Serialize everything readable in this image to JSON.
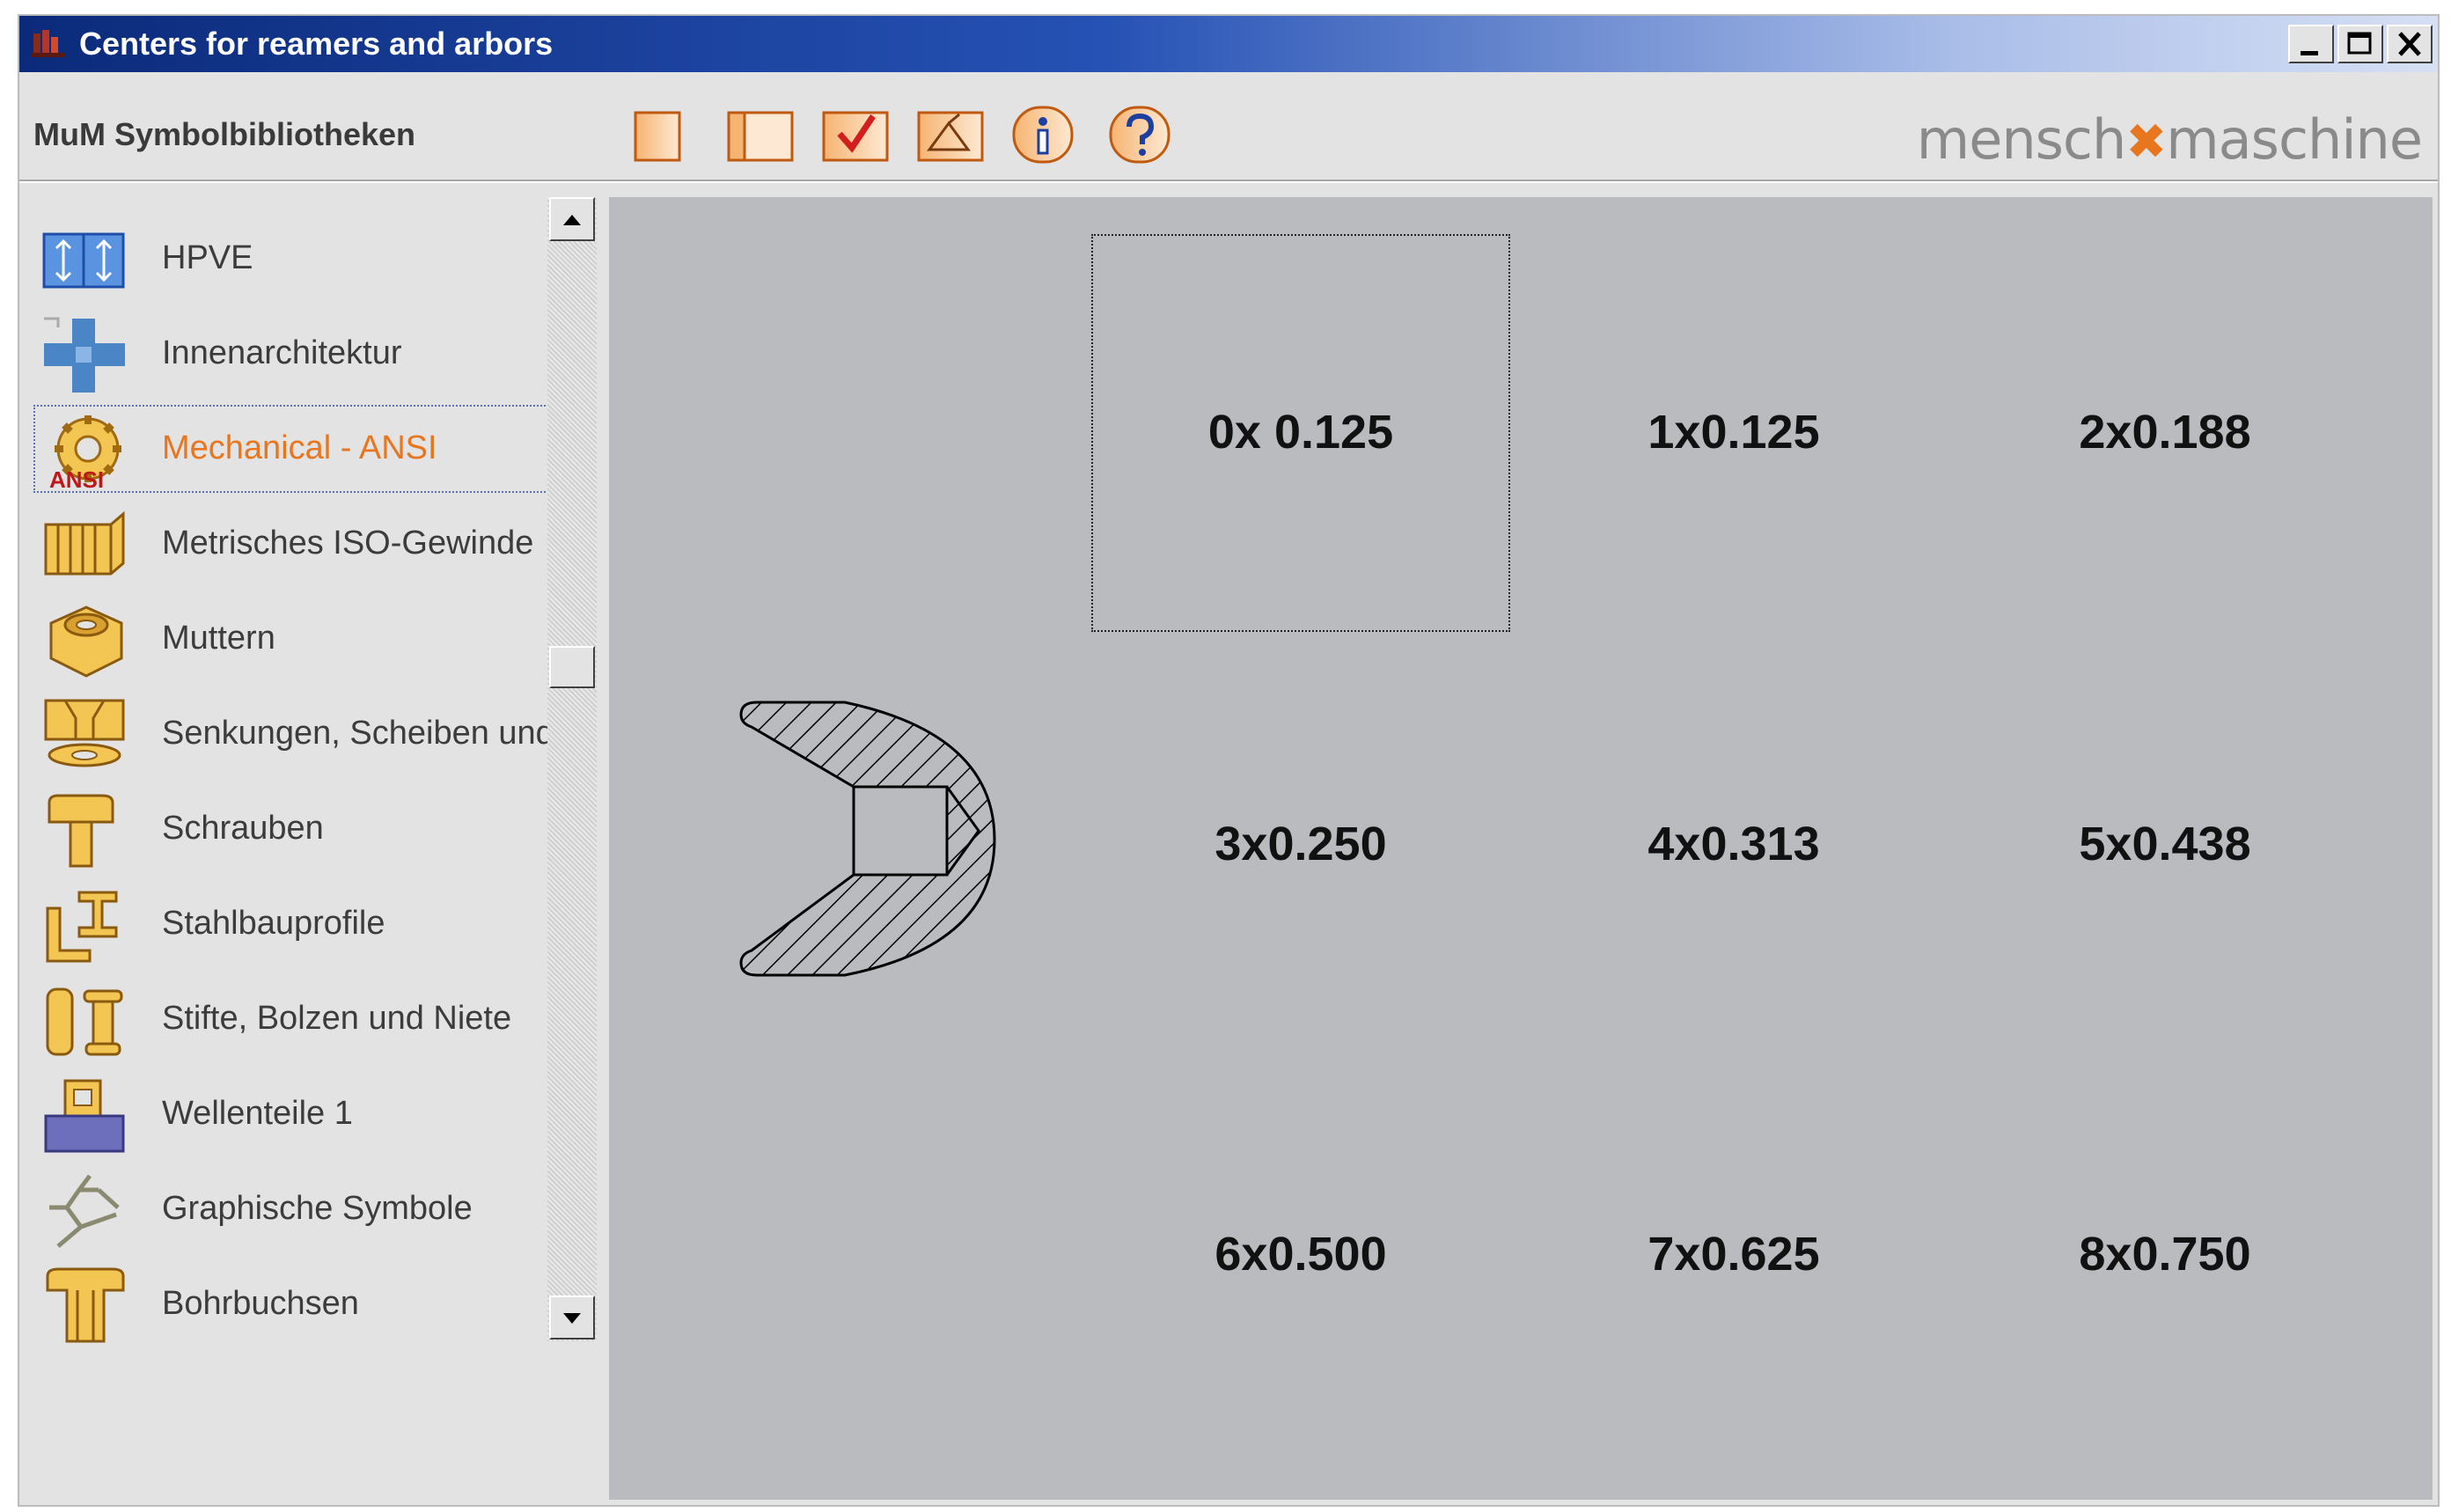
{
  "window": {
    "title": "Centers for reamers and arbors",
    "buttons": [
      "minimize",
      "maximize",
      "close"
    ]
  },
  "toolbar": {
    "label": "MuM Symbolbibliotheken",
    "tools": [
      {
        "icon": "single-page-icon"
      },
      {
        "icon": "two-panel-icon"
      },
      {
        "icon": "check-icon"
      },
      {
        "icon": "insert-icon"
      },
      {
        "icon": "info-icon"
      },
      {
        "icon": "help-icon"
      }
    ],
    "brand": {
      "left": "mensch",
      "right": "maschine"
    }
  },
  "sidebar": {
    "items": [
      {
        "label": "HPVE",
        "icon": "hpve-icon"
      },
      {
        "label": "Innenarchitektur",
        "icon": "interior-architecture-icon"
      },
      {
        "label": "Mechanical - ANSI",
        "icon": "mechanical-ansi-icon",
        "badge": "ANSI",
        "selected": true
      },
      {
        "label": "Metrisches ISO-Gewinde",
        "icon": "iso-thread-icon"
      },
      {
        "label": "Muttern",
        "icon": "nut-icon"
      },
      {
        "label": "Senkungen, Scheiben und Du",
        "icon": "countersink-washer-icon"
      },
      {
        "label": "Schrauben",
        "icon": "screw-icon"
      },
      {
        "label": "Stahlbauprofile",
        "icon": "steel-profile-icon"
      },
      {
        "label": "Stifte, Bolzen und Niete",
        "icon": "pin-bolt-rivet-icon"
      },
      {
        "label": "Wellenteile 1",
        "icon": "shaft-part-icon"
      },
      {
        "label": "Graphische Symbole",
        "icon": "graphic-symbols-icon"
      },
      {
        "label": "Bohrbuchsen",
        "icon": "drill-bushing-icon"
      }
    ]
  },
  "grid": {
    "cells": [
      "0x 0.125",
      "1x0.125",
      "2x0.188",
      "3x0.250",
      "4x0.313",
      "5x0.438",
      "6x0.500",
      "7x0.625",
      "8x0.750"
    ],
    "selected_index": 0,
    "preview": "center-hole-section-icon"
  }
}
